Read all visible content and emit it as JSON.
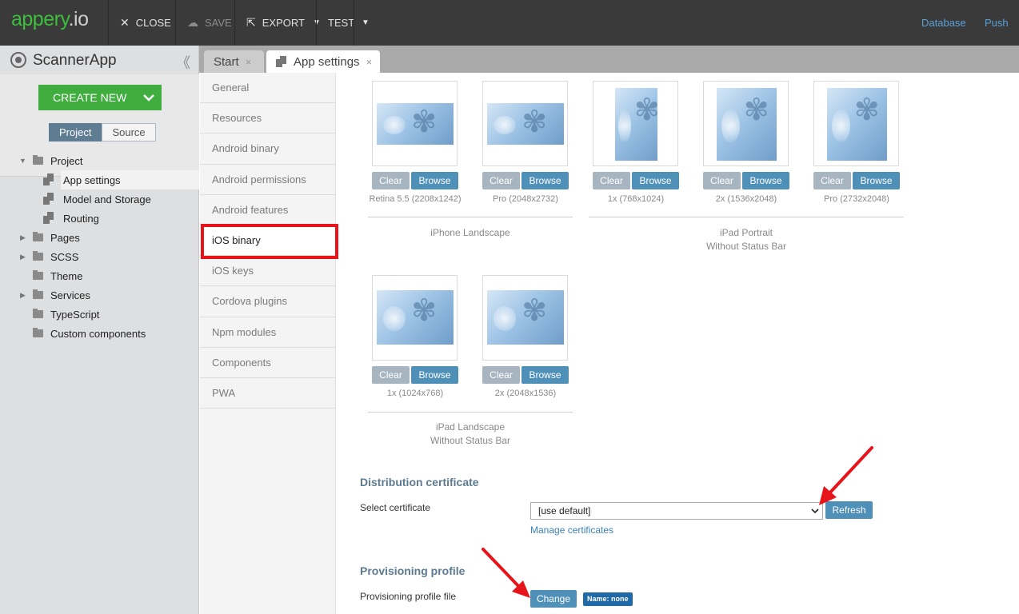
{
  "topbar": {
    "logo_main": "appery",
    "logo_suffix": ".io",
    "close": "CLOSE",
    "save": "SAVE",
    "export": "EXPORT",
    "test": "TEST",
    "database": "Database",
    "push": "Push"
  },
  "project": {
    "name": "ScannerApp",
    "create_new": "CREATE NEW",
    "tabs": [
      "Project",
      "Source"
    ],
    "tree": [
      {
        "label": "Project"
      },
      {
        "label": "App settings"
      },
      {
        "label": "Model and Storage"
      },
      {
        "label": "Routing"
      },
      {
        "label": "Pages"
      },
      {
        "label": "SCSS"
      },
      {
        "label": "Theme"
      },
      {
        "label": "Services"
      },
      {
        "label": "TypeScript"
      },
      {
        "label": "Custom components"
      }
    ]
  },
  "tabs": [
    {
      "label": "Start",
      "close": "×"
    },
    {
      "label": "App settings",
      "close": "×"
    }
  ],
  "settings_menu": [
    "General",
    "Resources",
    "Android binary",
    "Android permissions",
    "Android features",
    "iOS binary",
    "iOS keys",
    "Cordova plugins",
    "Npm modules",
    "Components",
    "PWA"
  ],
  "images": {
    "clear_label": "Clear",
    "browse_label": "Browse",
    "captions": [
      "Retina 5.5 (2208x1242)",
      "Pro (2048x2732)",
      "1x (768x1024)",
      "2x (1536x2048)",
      "Pro (2732x2048)",
      "1x (1024x768)",
      "2x (2048x1536)"
    ],
    "groups": [
      {
        "title": "iPhone Landscape",
        "subtitle": ""
      },
      {
        "title": "iPad Portrait",
        "subtitle": "Without Status Bar"
      },
      {
        "title": "iPad Landscape",
        "subtitle": "Without Status Bar"
      }
    ]
  },
  "distribution": {
    "title": "Distribution certificate",
    "select_label": "Select certificate",
    "select_value": "[use default]",
    "refresh": "Refresh",
    "manage": "Manage certificates"
  },
  "provisioning": {
    "title": "Provisioning profile",
    "file_label": "Provisioning profile file",
    "change": "Change",
    "badge": "Name: none"
  },
  "colors": {
    "accent_green": "#3fae3f",
    "highlight_red": "#e8141b",
    "button_blue": "#4f90b8"
  }
}
